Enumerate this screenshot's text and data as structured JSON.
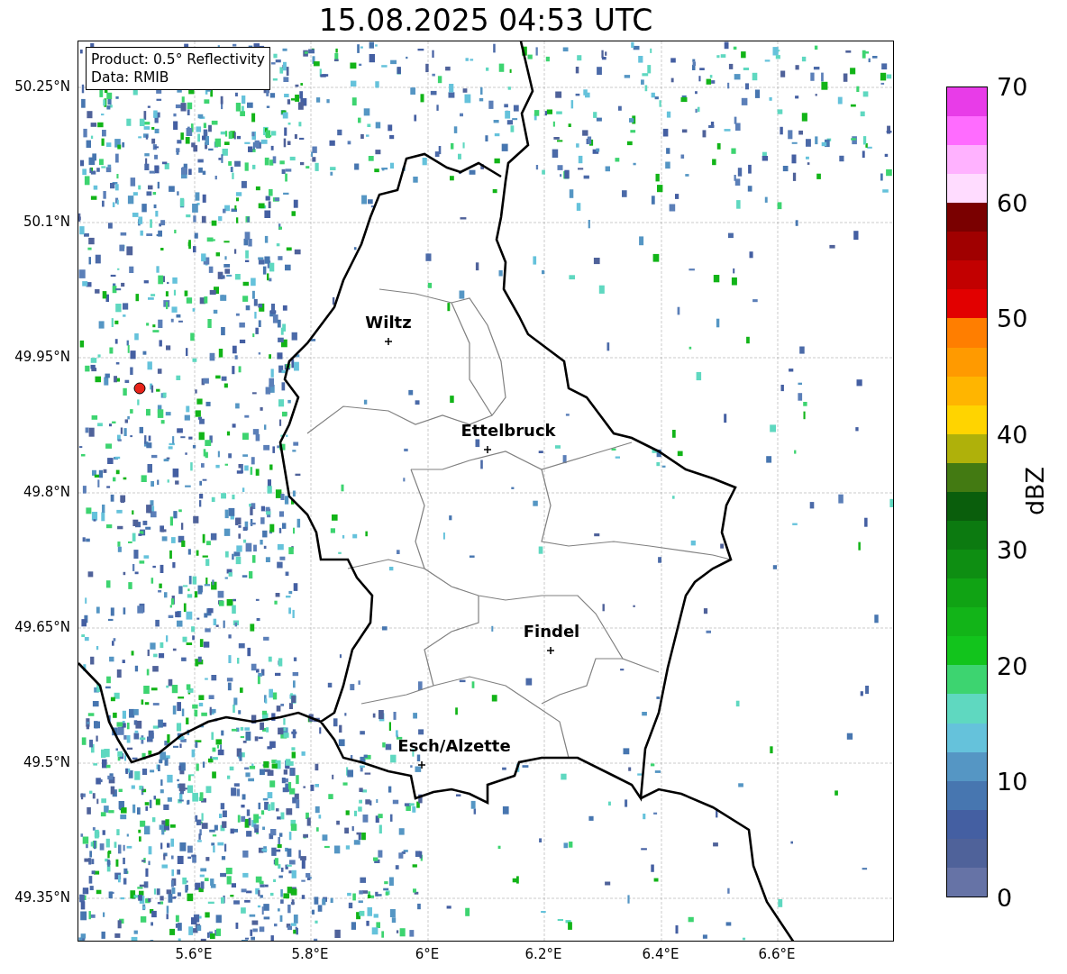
{
  "title": "15.08.2025 04:53 UTC",
  "info_box": [
    "Product: 0.5° Reflectivity",
    "Data: RMIB"
  ],
  "y_ticks": [
    "50.25°N",
    "50.1°N",
    "49.95°N",
    "49.8°N",
    "49.65°N",
    "49.5°N",
    "49.35°N"
  ],
  "x_ticks": [
    "5.6°E",
    "5.8°E",
    "6°E",
    "6.2°E",
    "6.4°E",
    "6.6°E"
  ],
  "cities": [
    {
      "name": "Wiltz"
    },
    {
      "name": "Ettelbruck"
    },
    {
      "name": "Findel"
    },
    {
      "name": "Esch/Alzette"
    }
  ],
  "colorbar": {
    "label": "dBZ",
    "ticks": [
      "70",
      "60",
      "50",
      "40",
      "30",
      "20",
      "10",
      "0"
    ],
    "segments": [
      {
        "color": "#6673a6"
      },
      {
        "color": "#4f629a"
      },
      {
        "color": "#445fa2"
      },
      {
        "color": "#4776b0"
      },
      {
        "color": "#5596c4"
      },
      {
        "color": "#65c2db"
      },
      {
        "color": "#5fd8c0"
      },
      {
        "color": "#3dd470"
      },
      {
        "color": "#12c41c"
      },
      {
        "color": "#12b418"
      },
      {
        "color": "#10a314"
      },
      {
        "color": "#0e8e12"
      },
      {
        "color": "#0c7a10"
      },
      {
        "color": "#0a5e0c"
      },
      {
        "color": "#437a12"
      },
      {
        "color": "#afb10a"
      },
      {
        "color": "#ffd400"
      },
      {
        "color": "#ffb500"
      },
      {
        "color": "#ff9a00"
      },
      {
        "color": "#ff7e00"
      },
      {
        "color": "#e20000"
      },
      {
        "color": "#c20000"
      },
      {
        "color": "#a00000"
      },
      {
        "color": "#7a0000"
      },
      {
        "color": "#ffdcff"
      },
      {
        "color": "#ffb2ff"
      },
      {
        "color": "#ff6cff"
      },
      {
        "color": "#e83ce8"
      }
    ]
  }
}
